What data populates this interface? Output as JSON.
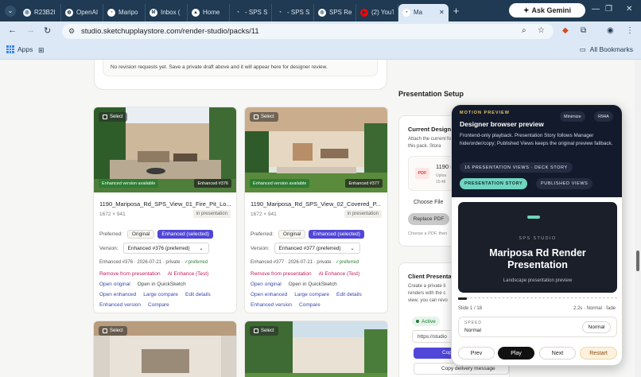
{
  "browser": {
    "tabs": [
      {
        "label": "R23B2I",
        "favicon_color": "#e8eef5",
        "fav_glyph": "◎"
      },
      {
        "label": "OpenAI",
        "favicon_color": "#ffffff",
        "fav_glyph": "◍"
      },
      {
        "label": "Maripo",
        "favicon_color": "#ffffff",
        "fav_glyph": "◔"
      },
      {
        "label": "Inbox (",
        "favicon_color": "#ffffff",
        "fav_glyph": "M"
      },
      {
        "label": "Home",
        "favicon_color": "#ffffff",
        "fav_glyph": "▲"
      },
      {
        "label": "- SPS St",
        "favicon_color": "#1f3a52",
        "fav_glyph": "◔"
      },
      {
        "label": "- SPS St",
        "favicon_color": "#1f3a52",
        "fav_glyph": "◔"
      },
      {
        "label": "SPS Ren",
        "favicon_color": "#ffffff",
        "fav_glyph": "◎"
      },
      {
        "label": "(2) YouT",
        "favicon_color": "#ff0000",
        "fav_glyph": "▶"
      },
      {
        "label": "Ma",
        "favicon_color": "#ffffff",
        "fav_glyph": "◔",
        "active": true
      }
    ],
    "ask_gemini": "Ask Gemini",
    "url": "studio.sketchupplaystore.com/render-studio/packs/11",
    "bookmarks_apps": "Apps",
    "all_bookmarks": "All Bookmarks"
  },
  "revision": {
    "empty_text": "No revision requests yet. Save a private draft above and it will appear here for designer review."
  },
  "cards": [
    {
      "select": "Select",
      "enhanced_available": "Enhanced version available",
      "enhanced_num": "Enhanced #376",
      "title": "1190_Mariposa_Rd_SPS_View_01_Fire_Pit_Lo...",
      "dims": "1672 × 941",
      "in_presentation": "in presentation",
      "preferred_label": "Preferred:",
      "original": "Original",
      "enhanced_selected": "Enhanced (selected)",
      "version_label": "Version:",
      "version_value": "Enhanced #376 (preferred)",
      "meta_prefix": "Enhanced #376 · 2026-07-21 · private · ",
      "meta_pref": "✓preferred",
      "links1": [
        "Remove from presentation",
        "AI Enhance (Test)"
      ],
      "links2": [
        "Open original",
        "Open in QuickSketch"
      ],
      "links3": [
        "Open enhanced",
        "Large compare",
        "Edit details"
      ],
      "links4": [
        "Enhanced version",
        "Compare"
      ]
    },
    {
      "select": "Select",
      "enhanced_available": "Enhanced version available",
      "enhanced_num": "Enhanced #377",
      "title": "1190_Mariposa_Rd_SPS_View_02_Covered_P...",
      "dims": "1672 × 941",
      "in_presentation": "in presentation",
      "preferred_label": "Preferred:",
      "original": "Original",
      "enhanced_selected": "Enhanced (selected)",
      "version_label": "Version:",
      "version_value": "Enhanced #377 (preferred)",
      "meta_prefix": "Enhanced #377 · 2026-07-21 · private · ",
      "meta_pref": "✓preferred",
      "links1": [
        "Remove from presentation",
        "AI Enhance (Test)"
      ],
      "links2": [
        "Open original",
        "Open in QuickSketch"
      ],
      "links3": [
        "Open enhanced",
        "Large compare",
        "Edit details"
      ],
      "links4": [
        "Enhanced version",
        "Compare"
      ]
    }
  ],
  "lower_cards": [
    {
      "select": "Select"
    },
    {
      "select": "Select"
    }
  ],
  "right": {
    "presentation_setup": "Presentation Setup",
    "design_heading": "Current Design F",
    "design_desc": "Attach the current for this pack. Stora",
    "pdf_badge": "PDF",
    "pdf_name": "1190 r",
    "pdf_sub1": "Uploa",
    "pdf_sub2": "15:46",
    "choose_file": "Choose File",
    "replace_pdf": "Replace PDF",
    "choose_hint": "Choose a PDF, then",
    "client_heading": "Client Presentati",
    "client_desc": "Create a private li renders with the c view; you can revo",
    "active": "Active",
    "share_url": "https://studio",
    "copy": "Cop",
    "copy_delivery": "Copy delivery message"
  },
  "motion": {
    "kicker": "MOTION PREVIEW",
    "title": "Designer browser preview",
    "desc": "Frontend-only playback. Presentation Story follows Manager hide/order/copy; Published Views keeps the original preview fallback.",
    "minimize": "Minimize",
    "code": "R94A",
    "count": "16 PRESENTATION VIEWS · DECK STORY",
    "tab_story": "PRESENTATION STORY",
    "tab_published": "PUBLISHED VIEWS",
    "slide_studio": "SPS STUDIO",
    "slide_title_line1": "Mariposa Rd Render",
    "slide_title_line2": "Presentation",
    "slide_sub": "Landscape presentation preview",
    "progress_fraction": 0.0556,
    "slide_count": "Slide 1 / 18",
    "slide_timing": "2.2s · Normal · fade",
    "speed_label": "SPEED",
    "speed_value": "Normal",
    "speed_button": "Normal",
    "prev": "Prev",
    "play": "Play",
    "next": "Next",
    "restart": "Restart"
  }
}
